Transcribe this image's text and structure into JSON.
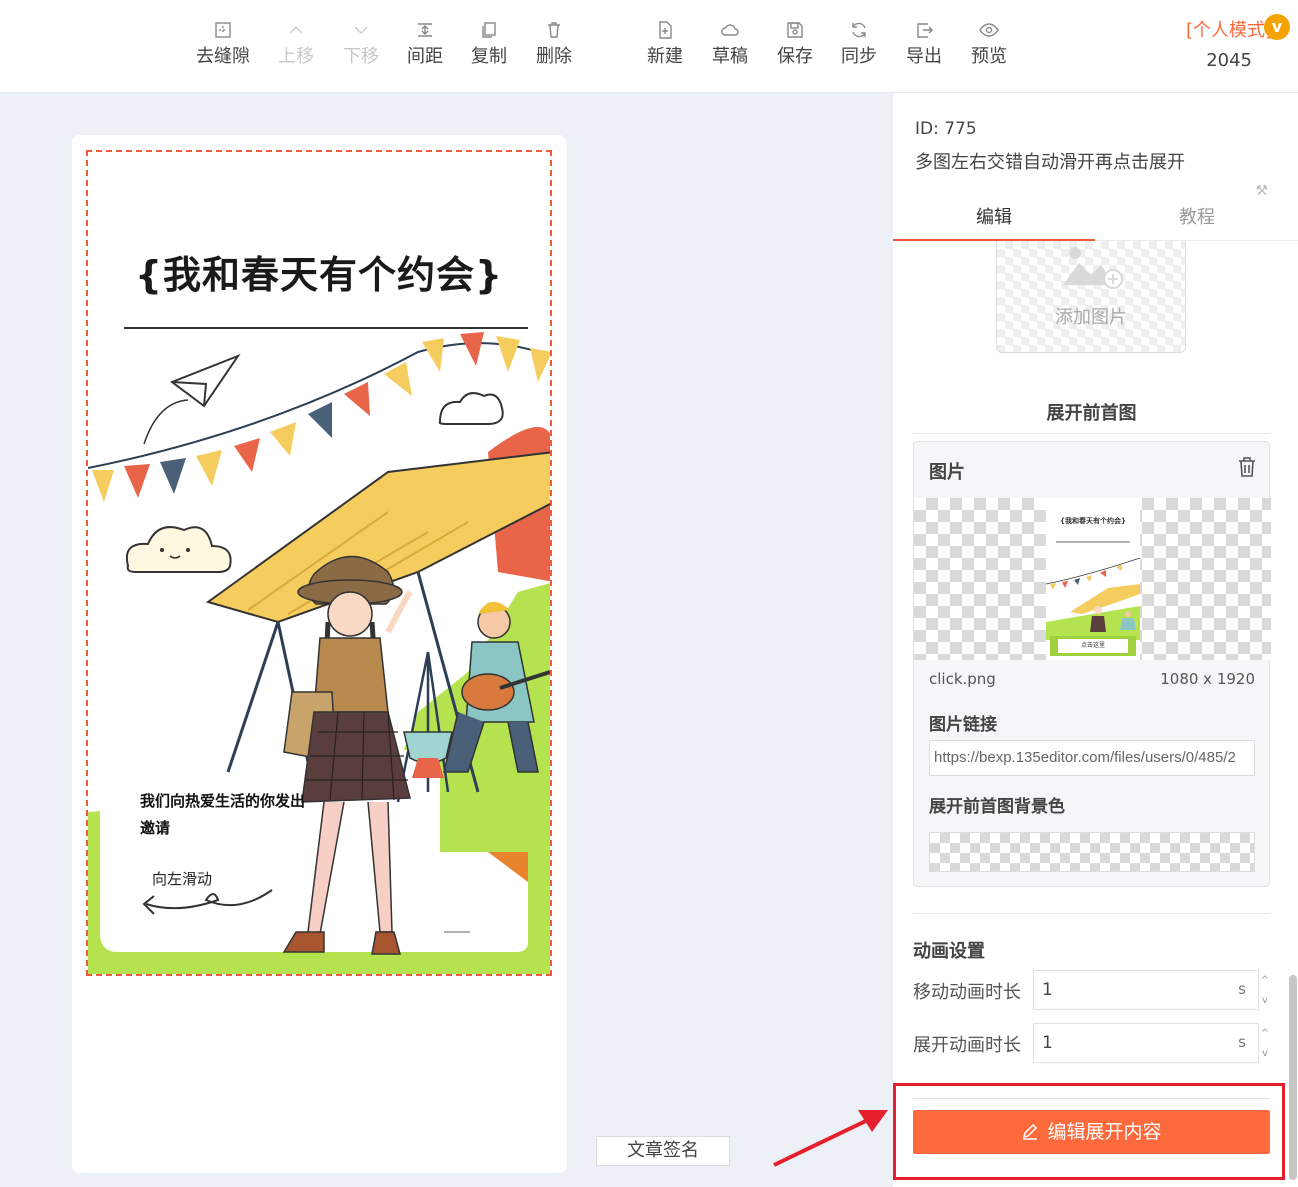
{
  "toolbar": {
    "items": [
      {
        "label": "去缝隙",
        "icon": "remove-gap-icon"
      },
      {
        "label": "上移",
        "icon": "chevron-up-icon",
        "disabled": true
      },
      {
        "label": "下移",
        "icon": "chevron-down-icon",
        "disabled": true
      },
      {
        "label": "间距",
        "icon": "spacing-icon"
      },
      {
        "label": "复制",
        "icon": "copy-icon"
      },
      {
        "label": "删除",
        "icon": "trash-icon"
      },
      {
        "label": "新建",
        "icon": "new-file-icon"
      },
      {
        "label": "草稿",
        "icon": "cloud-icon"
      },
      {
        "label": "保存",
        "icon": "save-icon"
      },
      {
        "label": "同步",
        "icon": "sync-icon"
      },
      {
        "label": "导出",
        "icon": "export-icon"
      },
      {
        "label": "预览",
        "icon": "eye-icon"
      }
    ],
    "mode_label": "[个人模式]",
    "mode_badge": "v",
    "mode_number": "2045"
  },
  "poster": {
    "title": "{我和春天有个约会}",
    "invite_text": "我们向热爱生活的你发出邀请",
    "swipe_hint": "向左滑动"
  },
  "canvas": {
    "signature_button": "文章签名"
  },
  "panel": {
    "id_label": "ID: 775",
    "template_name": "多图左右交错自动滑开再点击展开",
    "tabs": [
      {
        "label": "编辑",
        "active": true
      },
      {
        "label": "教程",
        "active": false
      }
    ],
    "add_image_label": "添加图片",
    "section_before_title": "展开前首图",
    "image_card": {
      "header": "图片",
      "thumb_title": "{我和春天有个约会}",
      "thumb_button": "点击这里",
      "file_name": "click.png",
      "file_size": "1080 x 1920",
      "link_label": "图片链接",
      "link_value": "https://bexp.135editor.com/files/users/0/485/2",
      "bg_label": "展开前首图背景色"
    },
    "animation": {
      "title": "动画设置",
      "move_label": "移动动画时长",
      "move_value": "1",
      "expand_label": "展开动画时长",
      "expand_value": "1",
      "unit": "s"
    },
    "edit_button": "编辑展开内容"
  },
  "colors": {
    "accent": "#ff6a3d",
    "highlight": "#e51f2b",
    "poster_green": "#b5e24f",
    "poster_yellow": "#f5cd5e"
  }
}
